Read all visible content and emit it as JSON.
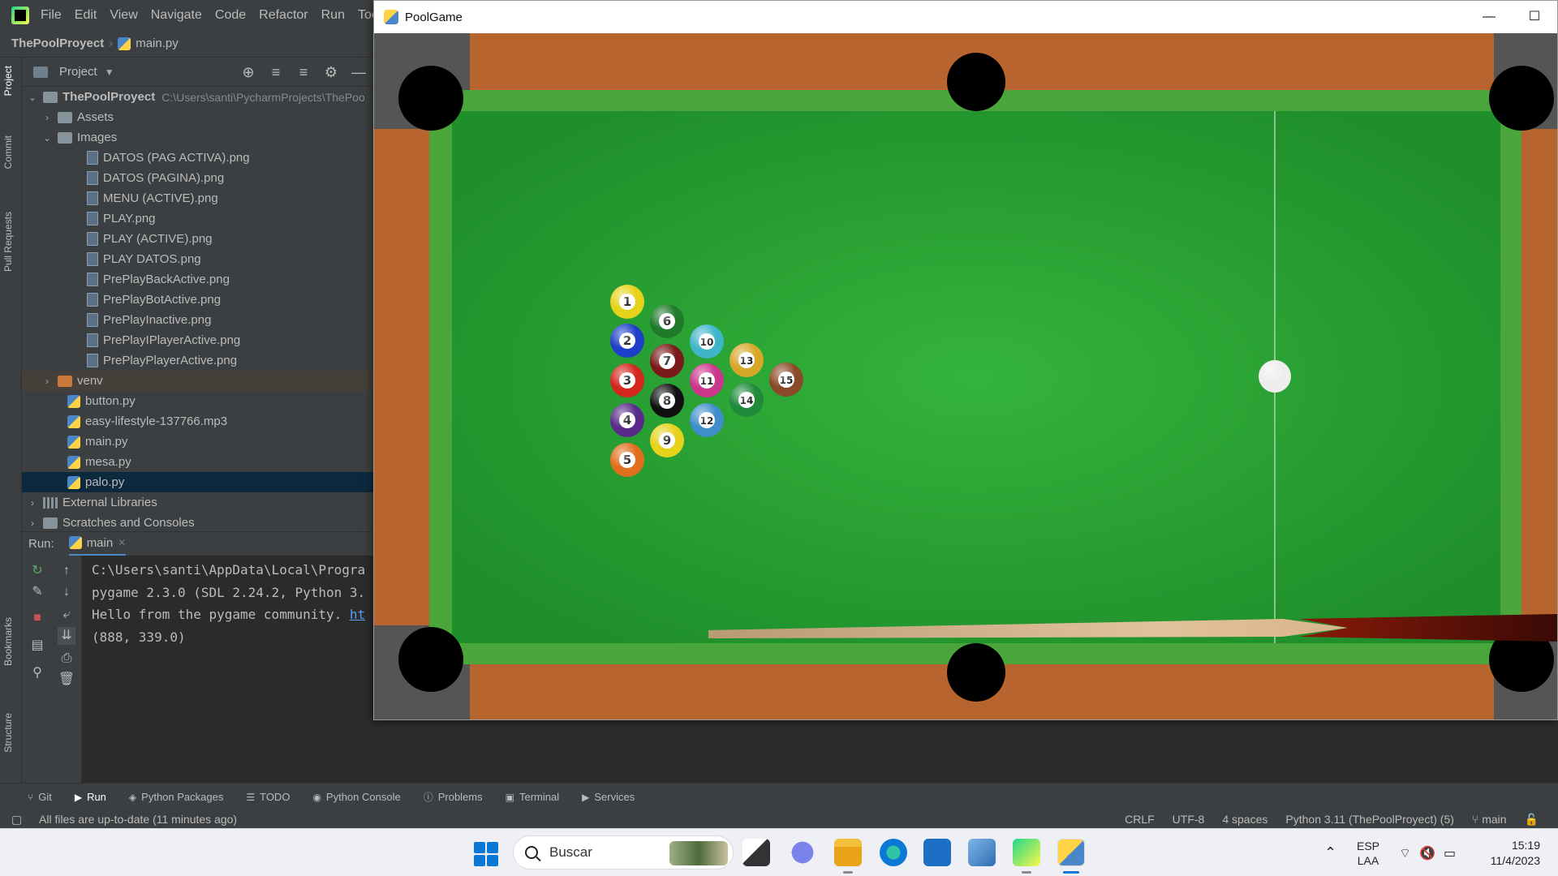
{
  "menu": {
    "items": [
      "File",
      "Edit",
      "View",
      "Navigate",
      "Code",
      "Refactor",
      "Run",
      "Tools"
    ]
  },
  "navbar": {
    "project": "ThePoolProyect",
    "file": "main.py"
  },
  "stripe": {
    "project": "Project",
    "commit": "Commit",
    "pull_requests": "Pull Requests",
    "bookmarks": "Bookmarks",
    "structure": "Structure"
  },
  "project_panel": {
    "title": "Project",
    "root": {
      "name": "ThePoolProyect",
      "path": "C:\\Users\\santi\\PycharmProjects\\ThePoo"
    },
    "assets": "Assets",
    "images": "Images",
    "image_files": [
      "DATOS (PAG ACTIVA).png",
      "DATOS (PAGINA).png",
      "MENU (ACTIVE).png",
      "PLAY.png",
      "PLAY (ACTIVE).png",
      "PLAY DATOS.png",
      "PrePlayBackActive.png",
      "PrePlayBotActive.png",
      "PrePlayInactive.png",
      "PrePlayIPlayerActive.png",
      "PrePlayPlayerActive.png"
    ],
    "venv": "venv",
    "py_files": [
      "button.py",
      "easy-lifestyle-137766.mp3",
      "main.py",
      "mesa.py",
      "palo.py"
    ],
    "external": "External Libraries",
    "scratches": "Scratches and Consoles"
  },
  "run": {
    "label": "Run:",
    "tab": "main",
    "console": [
      "C:\\Users\\santi\\AppData\\Local\\Progra",
      "pygame 2.3.0 (SDL 2.24.2, Python 3.",
      "Hello from the pygame community. ",
      "(888, 339.0)"
    ],
    "link": "ht"
  },
  "tool_tabs": [
    "Git",
    "Run",
    "Python Packages",
    "TODO",
    "Python Console",
    "Problems",
    "Terminal",
    "Services"
  ],
  "status": {
    "message": "All files are up-to-date (11 minutes ago)",
    "line_sep": "CRLF",
    "encoding": "UTF-8",
    "indent": "4 spaces",
    "interpreter": "Python 3.11 (ThePoolProyect) (5)",
    "branch": "main"
  },
  "taskbar": {
    "search_placeholder": "Buscar",
    "lang_top": "ESP",
    "lang_bottom": "LAA",
    "time": "15:19",
    "date": "11/4/2023"
  },
  "pool_window": {
    "title": "PoolGame",
    "colors": {
      "felt": "#2fae37",
      "rail_green": "#4aa63a",
      "wood": "#b8642e",
      "corner": "#555555",
      "pocket": "#000000"
    },
    "balls": [
      {
        "n": "1",
        "color": "#e6d21a"
      },
      {
        "n": "2",
        "color": "#1f3fc9"
      },
      {
        "n": "3",
        "color": "#d3261e"
      },
      {
        "n": "4",
        "color": "#5a2a8a"
      },
      {
        "n": "5",
        "color": "#e0701e"
      },
      {
        "n": "6",
        "color": "#1f7a2a"
      },
      {
        "n": "7",
        "color": "#7a1a1a"
      },
      {
        "n": "8",
        "color": "#111111"
      },
      {
        "n": "9",
        "color": "#e6d21a"
      },
      {
        "n": "10",
        "color": "#3fb5c9"
      },
      {
        "n": "11",
        "color": "#c9368a"
      },
      {
        "n": "12",
        "color": "#3f8ec9"
      },
      {
        "n": "13",
        "color": "#d6a82a"
      },
      {
        "n": "14",
        "color": "#1f8a3a"
      },
      {
        "n": "15",
        "color": "#8a4a2a"
      }
    ]
  }
}
